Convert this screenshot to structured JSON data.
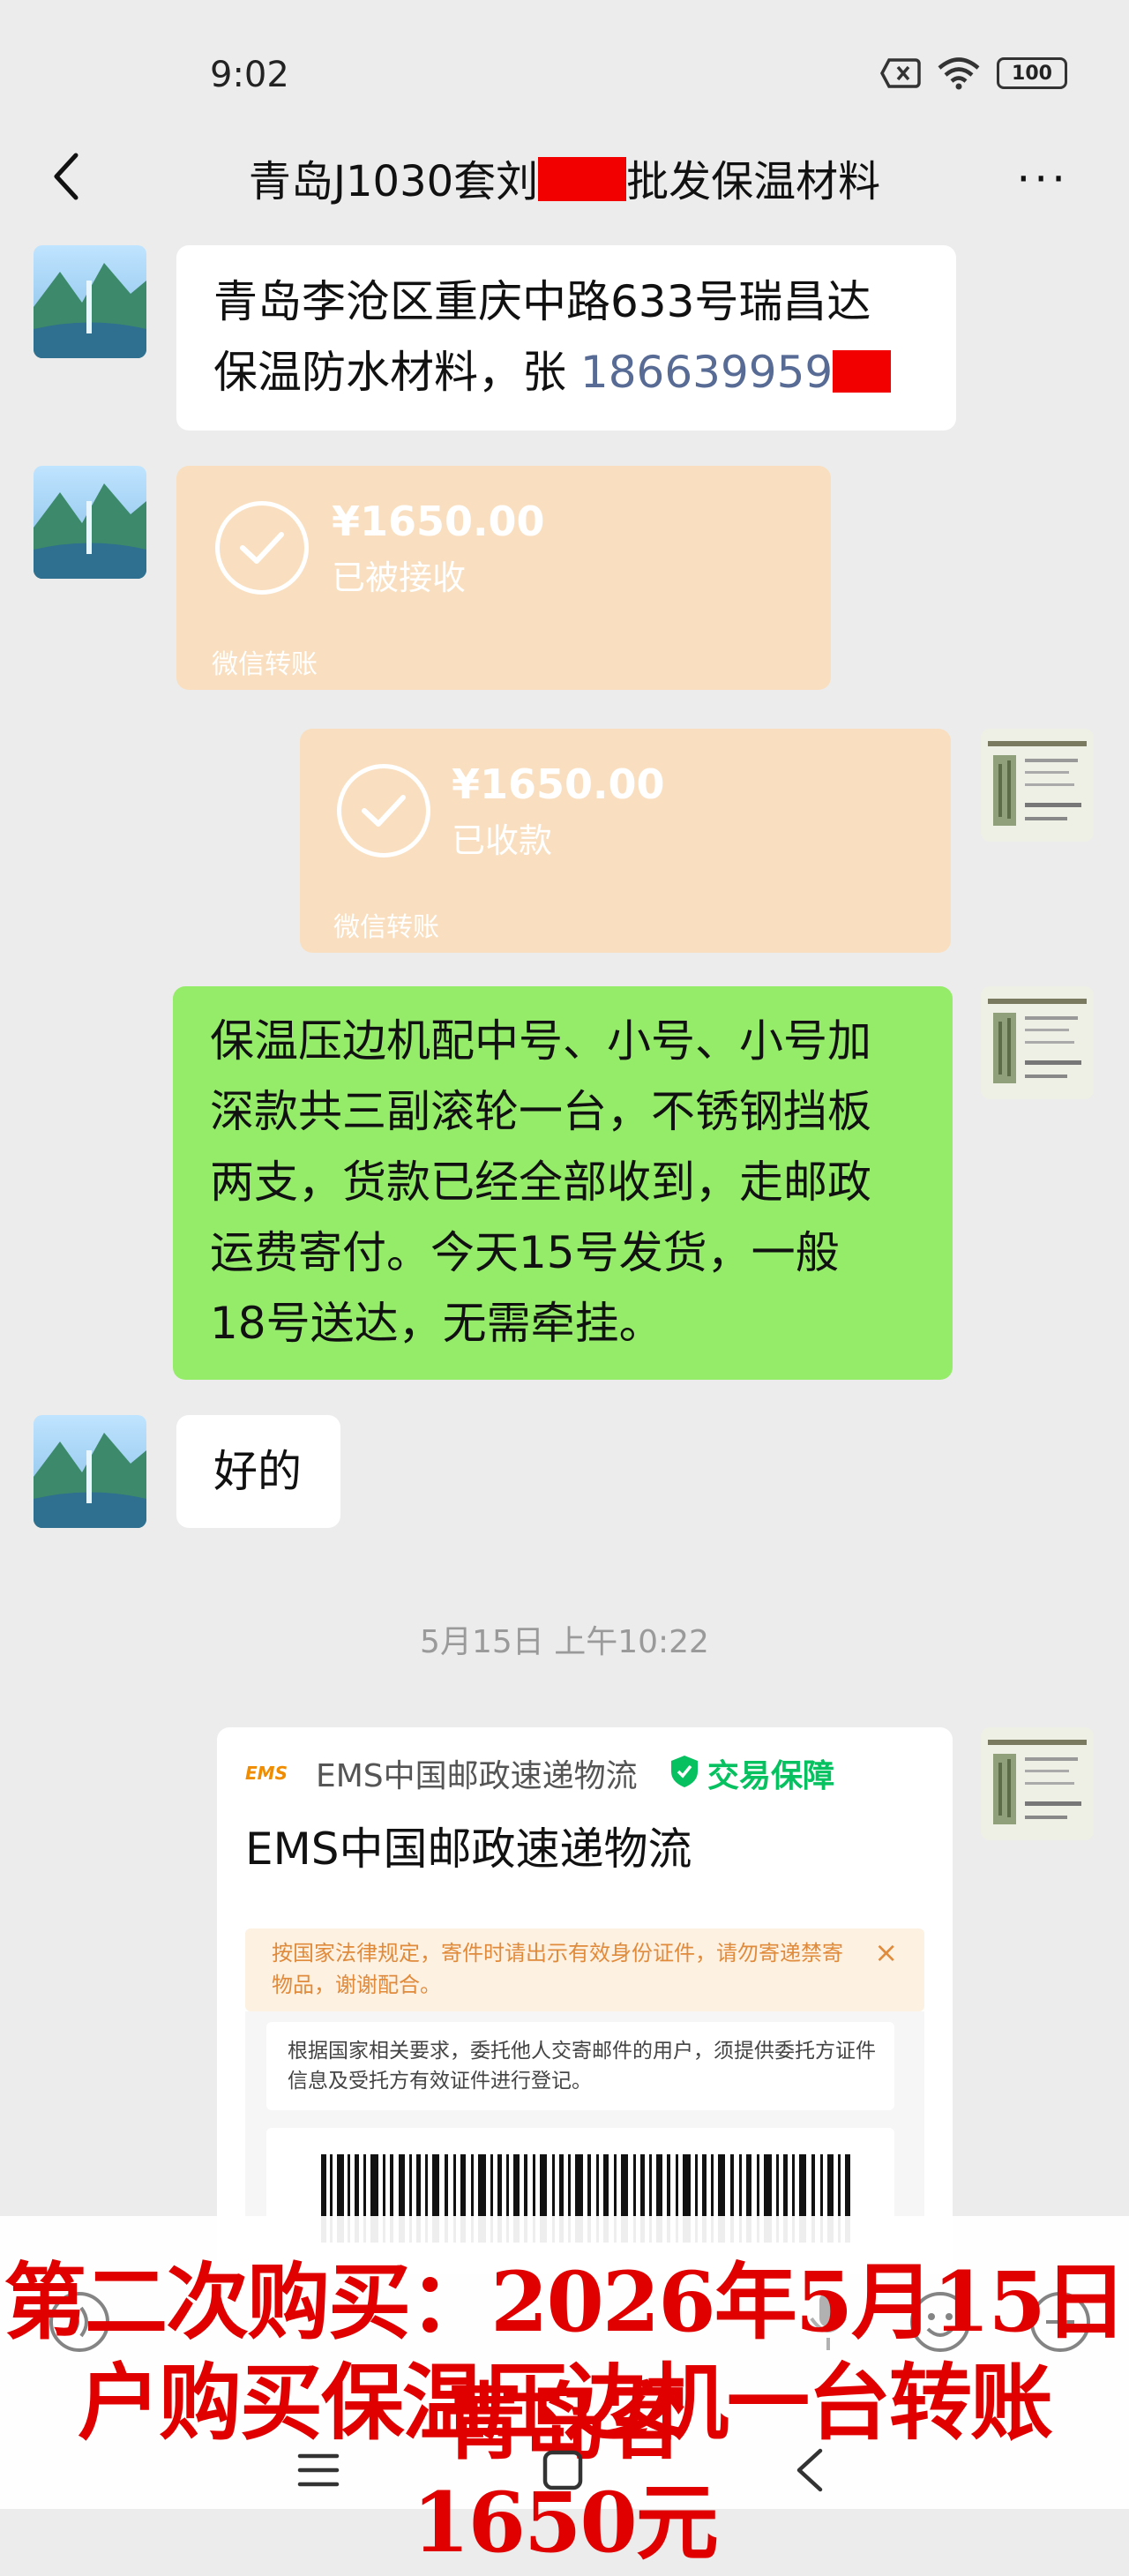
{
  "status_bar": {
    "time": "9:02",
    "battery": "100"
  },
  "header": {
    "title_prefix": "青岛J1030套刘",
    "title_suffix": "批发保温材料",
    "more": "···"
  },
  "messages": [
    {
      "id": "m1",
      "side": "left",
      "type": "text",
      "line1": "青岛李沧区重庆中路633号瑞昌达",
      "line2_text": "保温防水材料，张 ",
      "line2_phone": "186639959"
    },
    {
      "id": "m2",
      "side": "left",
      "type": "transfer",
      "amount": "¥1650.00",
      "status": "已被接收",
      "footer": "微信转账"
    },
    {
      "id": "m3",
      "side": "right",
      "type": "transfer",
      "amount": "¥1650.00",
      "status": "已收款",
      "footer": "微信转账"
    },
    {
      "id": "m4",
      "side": "right",
      "type": "text",
      "lines": [
        "保温压边机配中号、小号、小号加",
        "深款共三副滚轮一台，不锈钢挡板",
        "两支，货款已经全部收到，走邮政",
        "运费寄付。今天15号发货，一般",
        "18号送达，无需牵挂。"
      ]
    },
    {
      "id": "m5",
      "side": "left",
      "type": "text",
      "text": "好的"
    }
  ],
  "timestamp": "5月15日 上午10:22",
  "ems_card": {
    "logo": "EMS",
    "source": "EMS中国邮政速递物流",
    "badge": "交易保障",
    "title": "EMS中国邮政速递物流",
    "notice": "按国家法律规定，寄件时请出示有效身份证件，请勿寄递禁寄物品，谢谢配合。",
    "notice_close": "×",
    "info": "根据国家相关要求，委托他人交寄邮件的用户，须提供委托方证件信息及受托方有效证件进行登记。"
  },
  "caption": {
    "line1": "第二次购买：2026年5月15日青岛客",
    "line2": "户购买保温压边机一台转账1650元"
  },
  "colors": {
    "chat_bg": "#ececec",
    "green_bubble": "#95ec69",
    "transfer": "#f9dfbf",
    "caption_red": "#e10000",
    "badge_green": "#07c160"
  }
}
